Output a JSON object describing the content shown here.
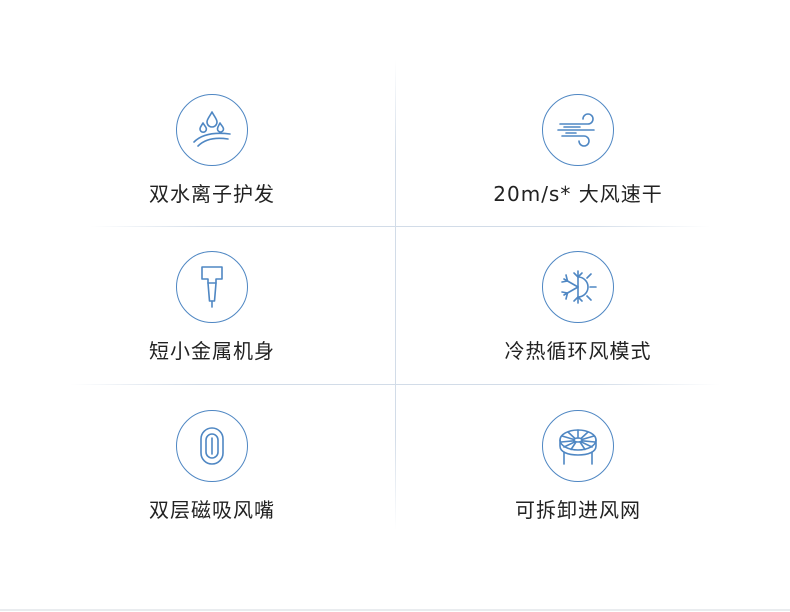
{
  "features": [
    {
      "label": "双水离子护发",
      "icon": "water-ion-icon"
    },
    {
      "label": "20m/s* 大风速干",
      "icon": "wind-icon"
    },
    {
      "label": "短小金属机身",
      "icon": "hair-dryer-icon"
    },
    {
      "label": "冷热循环风模式",
      "icon": "snowflake-sun-icon"
    },
    {
      "label": "双层磁吸风嘴",
      "icon": "magnetic-nozzle-icon"
    },
    {
      "label": "可拆卸进风网",
      "icon": "air-intake-filter-icon"
    }
  ],
  "colors": {
    "accent": "#4f87c3",
    "text": "#222222",
    "divider": "#d2dce8"
  }
}
